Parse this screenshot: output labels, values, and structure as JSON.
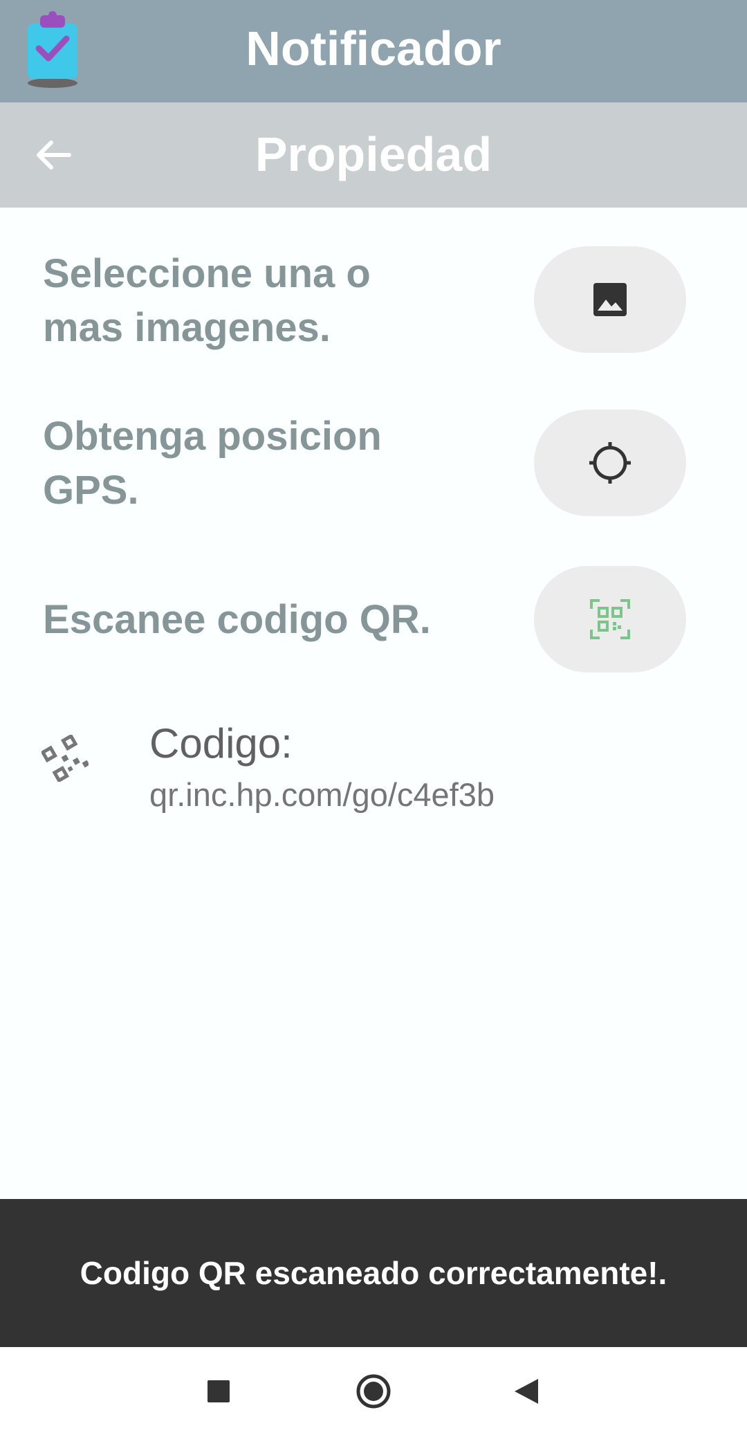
{
  "app": {
    "title": "Notificador",
    "logo_icon": "clipboard-check-icon"
  },
  "subheader": {
    "title": "Propiedad",
    "back_icon": "arrow-left-icon"
  },
  "actions": [
    {
      "label": "Seleccione una o mas imagenes.",
      "icon": "image-icon"
    },
    {
      "label": "Obtenga posicion GPS.",
      "icon": "crosshair-icon"
    },
    {
      "label": "Escanee codigo QR.",
      "icon": "qr-scan-icon"
    }
  ],
  "result": {
    "icon": "qr-code-icon",
    "label": "Codigo:",
    "value": "qr.inc.hp.com/go/c4ef3b"
  },
  "snackbar": {
    "message": "Codigo QR escaneado correctamente!."
  },
  "navigation": {
    "recents_icon": "square-icon",
    "home_icon": "circle-icon",
    "back_icon": "triangle-back-icon"
  },
  "colors": {
    "appbar": "#8fa4ae",
    "subbar": "#c9ced0",
    "label_text": "#869597",
    "button_bg": "#ececec",
    "qr_icon_green": "#7cc48a",
    "snackbar_bg": "#333333"
  }
}
